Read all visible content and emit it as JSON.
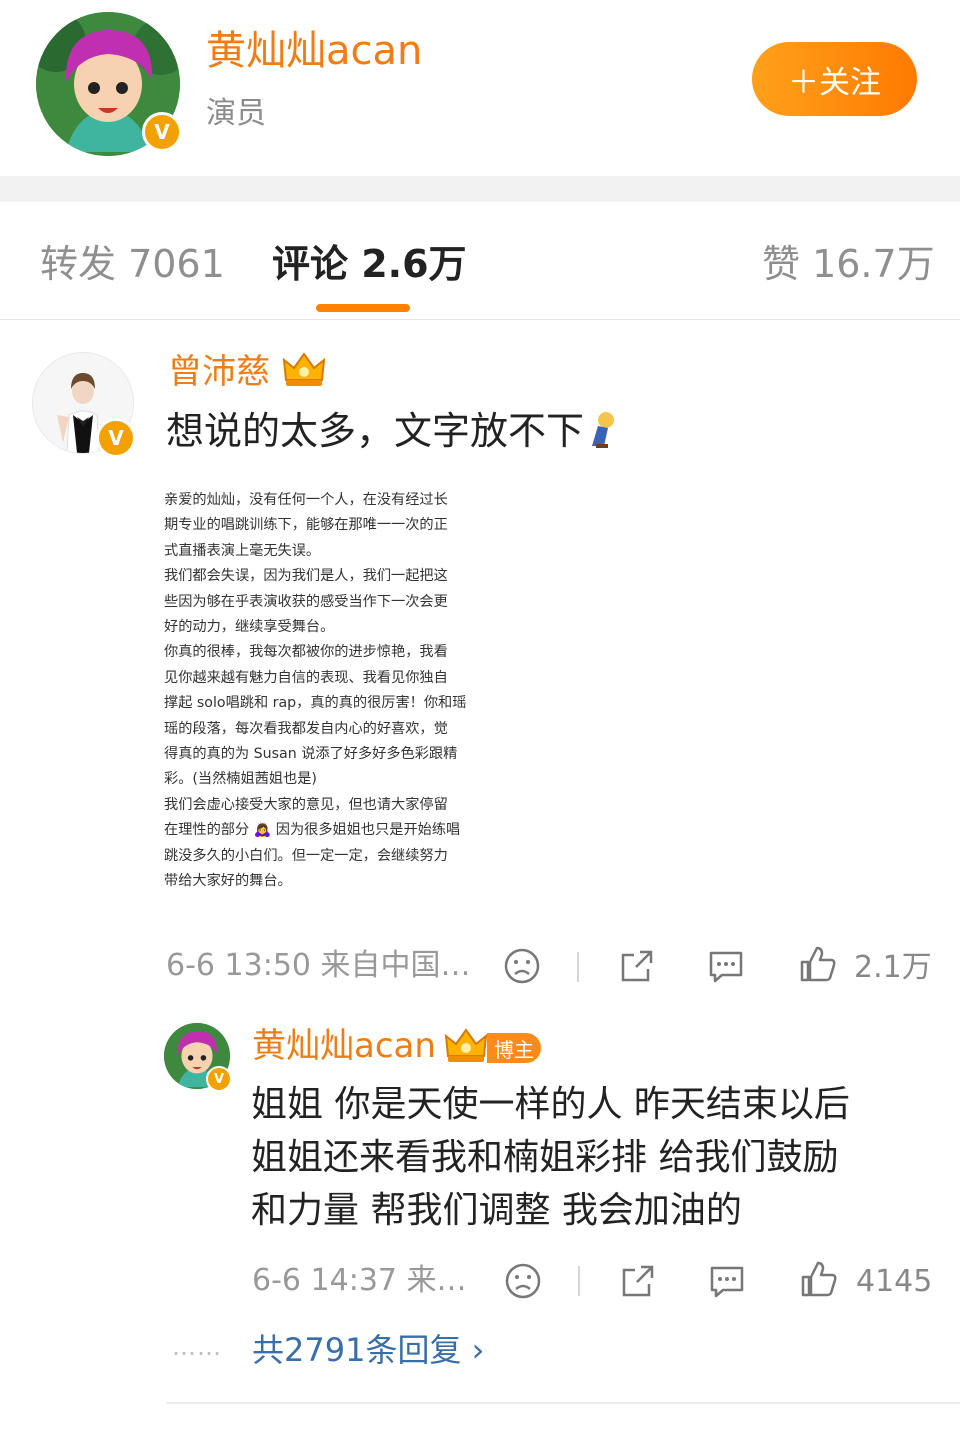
{
  "header": {
    "author_name": "黄灿灿acan",
    "author_role": "演员",
    "follow_label": "＋关注",
    "verified_badge": "V"
  },
  "tabs": [
    {
      "label": "转发 7061",
      "active": false
    },
    {
      "label": "评论 2.6万",
      "active": true
    },
    {
      "label": "赞 16.7万",
      "active": false
    }
  ],
  "comment": {
    "user_name": "曾沛慈",
    "text": "想说的太多，文字放不下",
    "letter_lines": [
      "亲爱的灿灿，没有任何一个人，在没有经过长",
      "期专业的唱跳训练下，能够在那唯一一次的正",
      "式直播表演上毫无失误。",
      "我们都会失误，因为我们是人，我们一起把这",
      "些因为够在乎表演收获的感受当作下一次会更",
      "好的动力，继续享受舞台。",
      "你真的很棒，我每次都被你的进步惊艳，我看",
      "见你越来越有魅力自信的表现、我看见你独自",
      "撑起 solo唱跳和 rap，真的真的很厉害！你和瑶",
      "瑶的段落，每次看我都发自内心的好喜欢，觉",
      "得真的真的为 Susan 说添了好多好多色彩跟精",
      "彩。(当然楠姐茜姐也是)",
      "我们会虚心接受大家的意见，但也请大家停留",
      "在理性的部分 🙇‍♀️ 因为很多姐姐也只是开始练唱",
      "跳没多久的小白们。但一定一定，会继续努力",
      "带给大家好的舞台。"
    ],
    "time_source": "6-6 13:50  来自中国…",
    "like_count": "2.1万"
  },
  "reply": {
    "user_name": "黄灿灿acan",
    "badge_label": "博主",
    "lines": [
      "姐姐 你是天使一样的人 昨天结束以后",
      "姐姐还来看我和楠姐彩排 给我们鼓励",
      "和力量 帮我们调整  我会加油的"
    ],
    "time_source": "6-6 14:37  来…",
    "like_count": "4145"
  },
  "more_replies": "共2791条回复 ›",
  "more_dots": "……",
  "colors": {
    "accent_orange": "#f07c14",
    "follow_gradient": "#ff8a00",
    "link_blue": "#3a6ea8",
    "tab_underline": "#ff8200"
  }
}
